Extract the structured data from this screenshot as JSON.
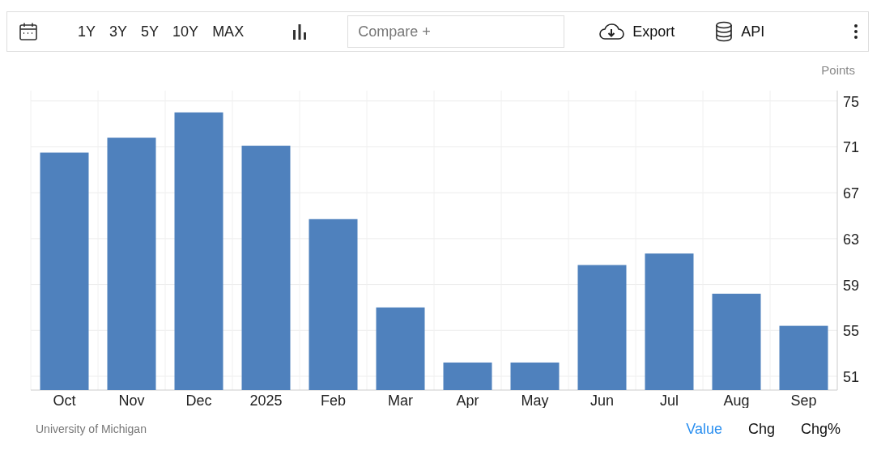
{
  "toolbar": {
    "ranges": [
      "1Y",
      "3Y",
      "5Y",
      "10Y",
      "MAX"
    ],
    "compare": {
      "placeholder": "Compare +"
    },
    "export": "Export",
    "api": "API"
  },
  "chart": {
    "chart_data": {
      "type": "bar",
      "ylabel": "Points",
      "categories": [
        "Oct",
        "Nov",
        "Dec",
        "2025",
        "Feb",
        "Mar",
        "Apr",
        "May",
        "Jun",
        "Jul",
        "Aug",
        "Sep"
      ],
      "grid": true,
      "series": [
        {
          "color": "#4f81bd",
          "values": [
            70.5,
            71.8,
            74.0,
            71.1,
            64.7,
            57.0,
            52.2,
            52.2,
            60.7,
            61.7,
            58.2,
            55.4
          ]
        }
      ],
      "ylim": [
        49.8,
        75.9
      ],
      "yticks": [
        51,
        55,
        59,
        63,
        67,
        71,
        75
      ]
    }
  },
  "footer": {
    "source": "University of Michigan",
    "modes": [
      {
        "label": "Value",
        "selected": true
      },
      {
        "label": "Chg",
        "selected": false
      },
      {
        "label": "Chg%",
        "selected": false
      }
    ]
  }
}
